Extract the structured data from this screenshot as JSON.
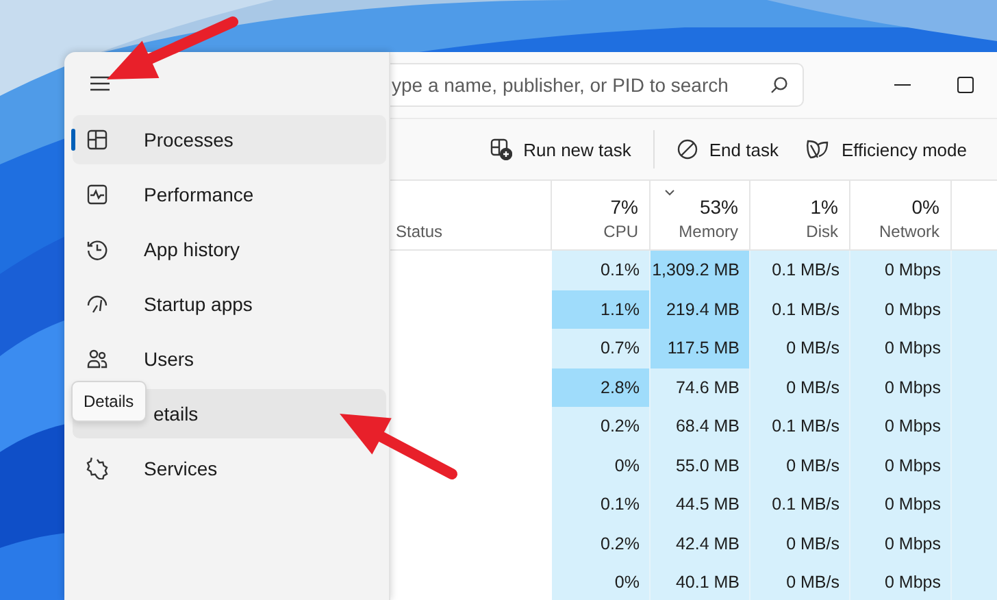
{
  "search": {
    "placeholder": "ype a name, publisher, or PID to search"
  },
  "nav": {
    "items": [
      {
        "label": "Processes",
        "selected": true
      },
      {
        "label": "Performance",
        "selected": false
      },
      {
        "label": "App history",
        "selected": false
      },
      {
        "label": "Startup apps",
        "selected": false
      },
      {
        "label": "Users",
        "selected": false
      },
      {
        "label": "etails",
        "selected": false,
        "hovered": true,
        "tooltip": "Details"
      },
      {
        "label": "Services",
        "selected": false
      }
    ]
  },
  "toolbar": {
    "buttons": [
      {
        "label": "Run new task"
      },
      {
        "label": "End task"
      },
      {
        "label": "Efficiency mode"
      }
    ]
  },
  "table": {
    "columns": [
      {
        "label": "Status"
      },
      {
        "label": "CPU",
        "percent": "7%",
        "sorted": false
      },
      {
        "label": "Memory",
        "percent": "53%",
        "sorted": true
      },
      {
        "label": "Disk",
        "percent": "1%",
        "sorted": false
      },
      {
        "label": "Network",
        "percent": "0%",
        "sorted": false
      }
    ],
    "rows": [
      {
        "cells": [
          {
            "text": ""
          },
          {
            "text": "0.1%",
            "hot": false
          },
          {
            "text": "1,309.2 MB",
            "hot": true
          },
          {
            "text": "0.1 MB/s",
            "hot": false
          },
          {
            "text": "0 Mbps",
            "hot": false
          }
        ]
      },
      {
        "cells": [
          {
            "text": ""
          },
          {
            "text": "1.1%",
            "hot": true
          },
          {
            "text": "219.4 MB",
            "hot": true
          },
          {
            "text": "0.1 MB/s",
            "hot": false
          },
          {
            "text": "0 Mbps",
            "hot": false
          }
        ]
      },
      {
        "cells": [
          {
            "text": ""
          },
          {
            "text": "0.7%",
            "hot": false
          },
          {
            "text": "117.5 MB",
            "hot": true
          },
          {
            "text": "0 MB/s",
            "hot": false
          },
          {
            "text": "0 Mbps",
            "hot": false
          }
        ]
      },
      {
        "cells": [
          {
            "text": ""
          },
          {
            "text": "2.8%",
            "hot": true
          },
          {
            "text": "74.6 MB",
            "hot": false
          },
          {
            "text": "0 MB/s",
            "hot": false
          },
          {
            "text": "0 Mbps",
            "hot": false
          }
        ]
      },
      {
        "cells": [
          {
            "text": ""
          },
          {
            "text": "0.2%",
            "hot": false
          },
          {
            "text": "68.4 MB",
            "hot": false
          },
          {
            "text": "0.1 MB/s",
            "hot": false
          },
          {
            "text": "0 Mbps",
            "hot": false
          }
        ]
      },
      {
        "cells": [
          {
            "text": ""
          },
          {
            "text": "0%",
            "hot": false
          },
          {
            "text": "55.0 MB",
            "hot": false
          },
          {
            "text": "0 MB/s",
            "hot": false
          },
          {
            "text": "0 Mbps",
            "hot": false
          }
        ]
      },
      {
        "cells": [
          {
            "text": ""
          },
          {
            "text": "0.1%",
            "hot": false
          },
          {
            "text": "44.5 MB",
            "hot": false
          },
          {
            "text": "0.1 MB/s",
            "hot": false
          },
          {
            "text": "0 Mbps",
            "hot": false
          }
        ]
      },
      {
        "cells": [
          {
            "text": ""
          },
          {
            "text": "0.2%",
            "hot": false
          },
          {
            "text": "42.4 MB",
            "hot": false
          },
          {
            "text": "0 MB/s",
            "hot": false
          },
          {
            "text": "0 Mbps",
            "hot": false
          }
        ]
      },
      {
        "cells": [
          {
            "text": ""
          },
          {
            "text": "0%",
            "hot": false
          },
          {
            "text": "40.1 MB",
            "hot": false
          },
          {
            "text": "0 MB/s",
            "hot": false
          },
          {
            "text": "0 Mbps",
            "hot": false
          }
        ]
      }
    ]
  }
}
